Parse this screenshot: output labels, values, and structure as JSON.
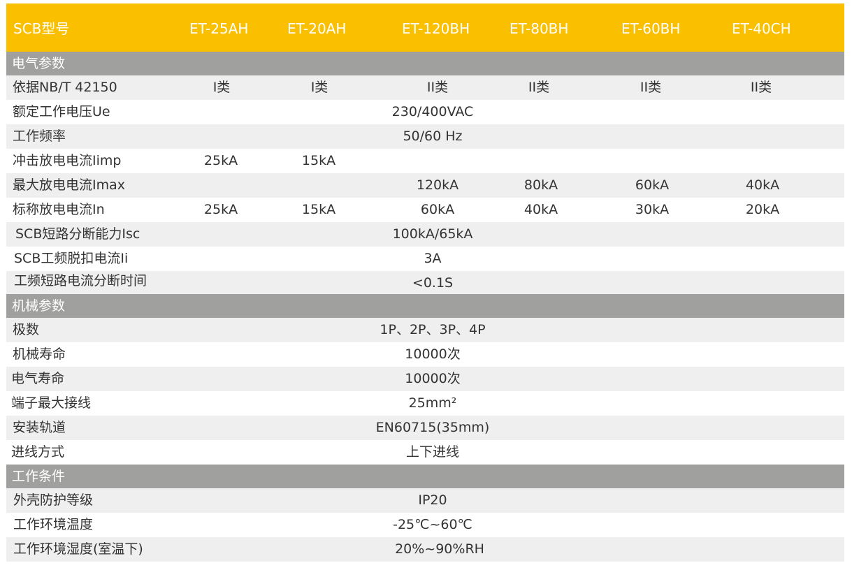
{
  "header": {
    "label": "SCB型号",
    "models": [
      "ET-25AH",
      "ET-20AH",
      "ET-120BH",
      "ET-80BH",
      "ET-60BH",
      "ET-40CH"
    ]
  },
  "sections": [
    {
      "title": "电气参数",
      "rows": [
        {
          "label": "依据NB/T 42150",
          "cells": [
            "I类",
            "I类",
            "II类",
            "II类",
            "II类",
            "II类"
          ]
        },
        {
          "label": "额定工作电压Ue",
          "span": "230/400VAC"
        },
        {
          "label": "工作频率",
          "span": "50/60 Hz"
        },
        {
          "label": "冲击放电电流Iimp",
          "cells": [
            "25kA",
            "15kA",
            "",
            "",
            "",
            ""
          ]
        },
        {
          "label": "最大放电电流Imax",
          "cells": [
            "",
            "",
            "120kA",
            "80kA",
            "60kA",
            "40kA"
          ]
        },
        {
          "label": "标称放电电流In",
          "cells": [
            "25kA",
            "15kA",
            "60kA",
            "40kA",
            "30kA",
            "20kA"
          ]
        },
        {
          "label": "SCB短路分断能力Isc",
          "span": "100kA/65kA"
        },
        {
          "label": "SCB工频脱扣电流Ii",
          "span": "3A"
        },
        {
          "label": "工频短路电流分断时间",
          "span": "<0.1S"
        }
      ]
    },
    {
      "title": "机械参数",
      "rows": [
        {
          "label": "极数",
          "span": "1P、2P、3P、4P"
        },
        {
          "label": "机械寿命",
          "span": "10000次"
        },
        {
          "label": "电气寿命",
          "span": "10000次"
        },
        {
          "label": "端子最大接线",
          "span": "25mm²"
        },
        {
          "label": "安装轨道",
          "span": "EN60715(35mm)"
        },
        {
          "label": "进线方式",
          "span": "上下进线"
        }
      ]
    },
    {
      "title": "工作条件",
      "rows": [
        {
          "label": "外壳防护等级",
          "span": "IP20"
        },
        {
          "label": "工作环境温度",
          "span": "-25℃~60℃"
        },
        {
          "label": "工作环境湿度(室温下)",
          "span": "20%~90%RH"
        }
      ]
    }
  ],
  "colors": {
    "header": "#fac000",
    "section": "#a0a09f",
    "stripe": "#efefef"
  }
}
